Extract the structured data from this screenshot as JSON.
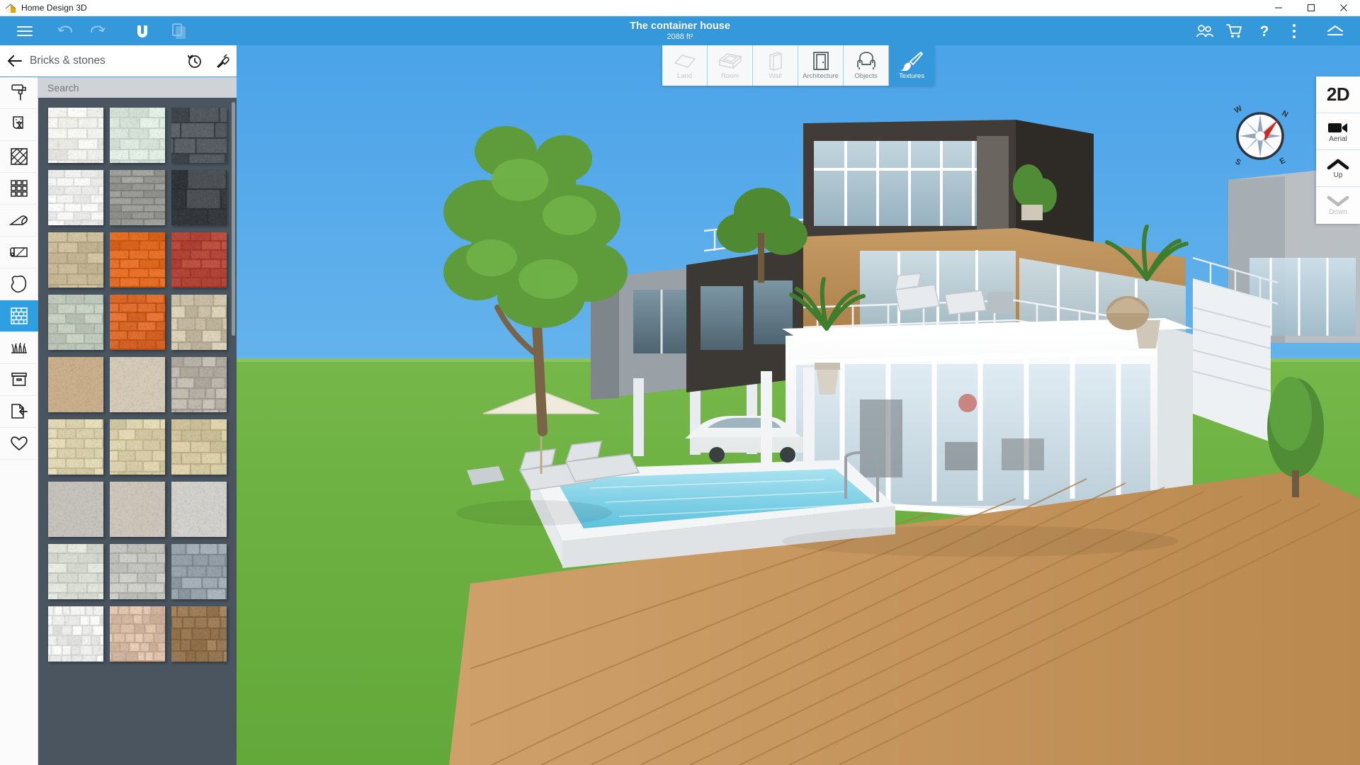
{
  "window": {
    "app_title": "Home Design 3D",
    "logo_icon": "app-logo-icon",
    "minimize_icon": "minimize-icon",
    "maximize_icon": "maximize-icon",
    "close_icon": "close-icon"
  },
  "appbar": {
    "menu_icon": "hamburger-menu-icon",
    "undo_icon": "undo-icon",
    "redo_icon": "redo-icon",
    "magnet_icon": "magnet-snap-icon",
    "copy_icon": "copy-paste-icon",
    "project_title": "The container house",
    "project_area": "2088 ft²",
    "right_icons": [
      {
        "name": "community-icon",
        "label": "Community"
      },
      {
        "name": "shopping-cart-icon",
        "label": "Shop"
      },
      {
        "name": "help-icon",
        "label": "Help"
      },
      {
        "name": "more-options-icon",
        "label": "More"
      },
      {
        "name": "collapse-toolbar-icon",
        "label": "Collapse"
      }
    ]
  },
  "rail": {
    "items": [
      {
        "name": "paint-roller-icon",
        "label": "Paints",
        "active": false
      },
      {
        "name": "wallpaper-icon",
        "label": "Wallpapers",
        "active": false
      },
      {
        "name": "parquet-icon",
        "label": "Parquet",
        "active": false
      },
      {
        "name": "tiles-icon",
        "label": "Tiles",
        "active": false
      },
      {
        "name": "carpet-icon",
        "label": "Carpets",
        "active": false
      },
      {
        "name": "linoleum-icon",
        "label": "Linoleum",
        "active": false
      },
      {
        "name": "leather-icon",
        "label": "Leather",
        "active": false
      },
      {
        "name": "bricks-stones-icon",
        "label": "Bricks & stones",
        "active": true
      },
      {
        "name": "grass-icon",
        "label": "Grass",
        "active": false
      },
      {
        "name": "materials-box-icon",
        "label": "Materials",
        "active": false
      },
      {
        "name": "import-texture-icon",
        "label": "Import",
        "active": false
      },
      {
        "name": "favorites-heart-icon",
        "label": "Favorites",
        "active": false
      }
    ]
  },
  "panel": {
    "back_icon": "back-arrow-icon",
    "title": "Bricks & stones",
    "history_icon": "recent-history-icon",
    "eyedropper_icon": "eyedropper-icon",
    "search_placeholder": "Search",
    "search_value": "",
    "swatches": [
      {
        "name": "white-subway-brick",
        "c1": "#f2f2ee",
        "c2": "#dcdcd4",
        "pattern": "brick",
        "bw": 26,
        "bh": 13
      },
      {
        "name": "pale-green-brick",
        "c1": "#dfeae0",
        "c2": "#c6d5c7",
        "pattern": "brick",
        "bw": 26,
        "bh": 13
      },
      {
        "name": "dark-slate-stone",
        "c1": "#4e545a",
        "c2": "#33383d",
        "pattern": "stone",
        "bw": 39,
        "bh": 20
      },
      {
        "name": "white-rough-brick",
        "c1": "#f6f6f4",
        "c2": "#dedede",
        "pattern": "brick",
        "bw": 22,
        "bh": 10
      },
      {
        "name": "grey-thin-brick",
        "c1": "#9b9b98",
        "c2": "#7e7e7b",
        "pattern": "brick",
        "bw": 30,
        "bh": 8
      },
      {
        "name": "charcoal-stone",
        "c1": "#3b3f44",
        "c2": "#2a2d31",
        "pattern": "stone",
        "bw": 39,
        "bh": 26
      },
      {
        "name": "beige-stone-block",
        "c1": "#cdbf9d",
        "c2": "#b3a27d",
        "pattern": "brick",
        "bw": 26,
        "bh": 13
      },
      {
        "name": "orange-brick",
        "c1": "#e2691f",
        "c2": "#c8540f",
        "pattern": "brick",
        "bw": 26,
        "bh": 11
      },
      {
        "name": "red-brick",
        "c1": "#b9483a",
        "c2": "#9c3628",
        "pattern": "brick",
        "bw": 26,
        "bh": 11
      },
      {
        "name": "green-grey-brick",
        "c1": "#c4cdc0",
        "c2": "#a9b4a5",
        "pattern": "brick",
        "bw": 24,
        "bh": 12
      },
      {
        "name": "bright-orange-brick",
        "c1": "#e06a2a",
        "c2": "#bd5115",
        "pattern": "brick",
        "bw": 24,
        "bh": 11
      },
      {
        "name": "cream-rubble-stone",
        "c1": "#cfc5ad",
        "c2": "#b0a488",
        "pattern": "stone",
        "bw": 20,
        "bh": 15
      },
      {
        "name": "tan-sandstone",
        "c1": "#cbb08b",
        "c2": "#b3966f",
        "pattern": "plain",
        "bw": 40,
        "bh": 40
      },
      {
        "name": "light-sand-plaster",
        "c1": "#d6cbb8",
        "c2": "#bfb39d",
        "pattern": "plain",
        "bw": 40,
        "bh": 40
      },
      {
        "name": "grey-pebble-stone",
        "c1": "#c0b9ae",
        "c2": "#a09890",
        "pattern": "stone",
        "bw": 18,
        "bh": 13
      },
      {
        "name": "pale-ashlar-stone",
        "c1": "#e0d7b4",
        "c2": "#c7bb92",
        "pattern": "brick",
        "bw": 24,
        "bh": 12
      },
      {
        "name": "cream-cut-stone",
        "c1": "#ded3ae",
        "c2": "#c4b78c",
        "pattern": "brick",
        "bw": 22,
        "bh": 13
      },
      {
        "name": "sand-ashlar-stone",
        "c1": "#d7caa4",
        "c2": "#bdae83",
        "pattern": "brick",
        "bw": 26,
        "bh": 14
      },
      {
        "name": "grey-smooth-concrete",
        "c1": "#c7c3bd",
        "c2": "#aca7a0",
        "pattern": "plain",
        "bw": 40,
        "bh": 40
      },
      {
        "name": "beige-travertine",
        "c1": "#cfc6bb",
        "c2": "#b5aa9d",
        "pattern": "plain",
        "bw": 40,
        "bh": 40
      },
      {
        "name": "pale-grey-granite",
        "c1": "#d3d2cd",
        "c2": "#b6b5b0",
        "pattern": "plain",
        "bw": 40,
        "bh": 40
      },
      {
        "name": "whitewashed-brick",
        "c1": "#dfe3d9",
        "c2": "#c5cabd",
        "pattern": "brick",
        "bw": 26,
        "bh": 12
      },
      {
        "name": "light-grey-brick",
        "c1": "#c9c9c4",
        "c2": "#adada7",
        "pattern": "brick",
        "bw": 24,
        "bh": 12
      },
      {
        "name": "blue-grey-stone",
        "c1": "#9aa4ad",
        "c2": "#7b858e",
        "pattern": "stone",
        "bw": 22,
        "bh": 14
      },
      {
        "name": "white-pebbles",
        "c1": "#f3f3f1",
        "c2": "#dadad6",
        "pattern": "stone",
        "bw": 14,
        "bh": 12
      },
      {
        "name": "pink-gravel",
        "c1": "#ddc0ab",
        "c2": "#c6a68e",
        "pattern": "stone",
        "bw": 13,
        "bh": 11
      },
      {
        "name": "brown-cobblestone",
        "c1": "#9d7c55",
        "c2": "#7e6140",
        "pattern": "stone",
        "bw": 17,
        "bh": 14
      }
    ]
  },
  "viewport": {
    "mode_tabs": [
      {
        "name": "tab-land",
        "label": "Land",
        "icon": "land-plane-icon",
        "state": "disabled"
      },
      {
        "name": "tab-room",
        "label": "Room",
        "icon": "room-box-icon",
        "state": "disabled"
      },
      {
        "name": "tab-wall",
        "label": "Wall",
        "icon": "wall-slab-icon",
        "state": "disabled"
      },
      {
        "name": "tab-architecture",
        "label": "Architecture",
        "icon": "door-icon",
        "state": "normal"
      },
      {
        "name": "tab-objects",
        "label": "Objects",
        "icon": "armchair-icon",
        "state": "normal"
      },
      {
        "name": "tab-textures",
        "label": "Textures",
        "icon": "paintbrush-icon",
        "state": "active"
      }
    ],
    "compass": {
      "name": "compass-rose",
      "north": "N",
      "south": "S",
      "east": "E",
      "west": "W",
      "needle_color": "#d0261e"
    },
    "view_controls": [
      {
        "name": "view-2d-button",
        "label": "2D",
        "icon": "text-2d",
        "state": "normal"
      },
      {
        "name": "view-aerial-button",
        "label": "Aerial",
        "icon": "video-camera-icon",
        "state": "normal"
      },
      {
        "name": "view-up-button",
        "label": "Up",
        "icon": "chevron-up-icon",
        "state": "normal"
      },
      {
        "name": "view-down-button",
        "label": "Down",
        "icon": "chevron-down-icon",
        "state": "disabled"
      }
    ]
  },
  "colors": {
    "accent": "#3498db",
    "panel_bg": "#4a5560",
    "rail_bg": "#fbfbfb",
    "sky_top": "#4ba3e8",
    "grass": "#6fb244",
    "deck_wood": "#c89a61",
    "pool_water": "#7fd3e8"
  }
}
